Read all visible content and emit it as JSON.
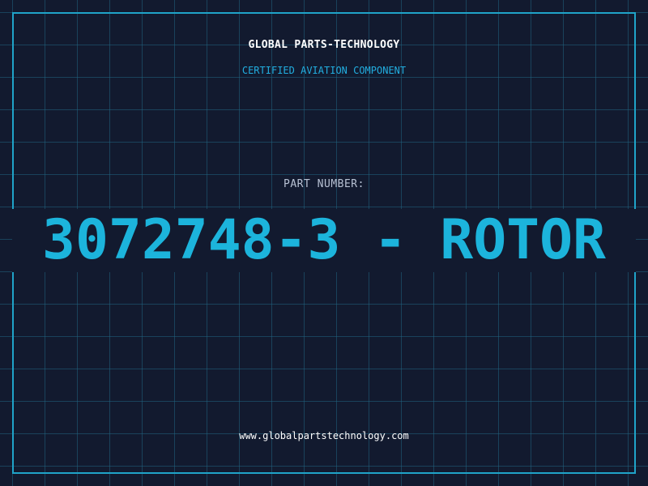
{
  "header": {
    "company": "GLOBAL PARTS-TECHNOLOGY",
    "tagline": "CERTIFIED AVIATION COMPONENT"
  },
  "part": {
    "label": "PART NUMBER:",
    "number": "3072748-3 - ROTOR"
  },
  "footer": {
    "website": "www.globalpartstechnology.com"
  },
  "colors": {
    "background": "#121a2f",
    "grid": "#206280",
    "accent": "#1cb4dc",
    "border": "#1fa3c8"
  }
}
